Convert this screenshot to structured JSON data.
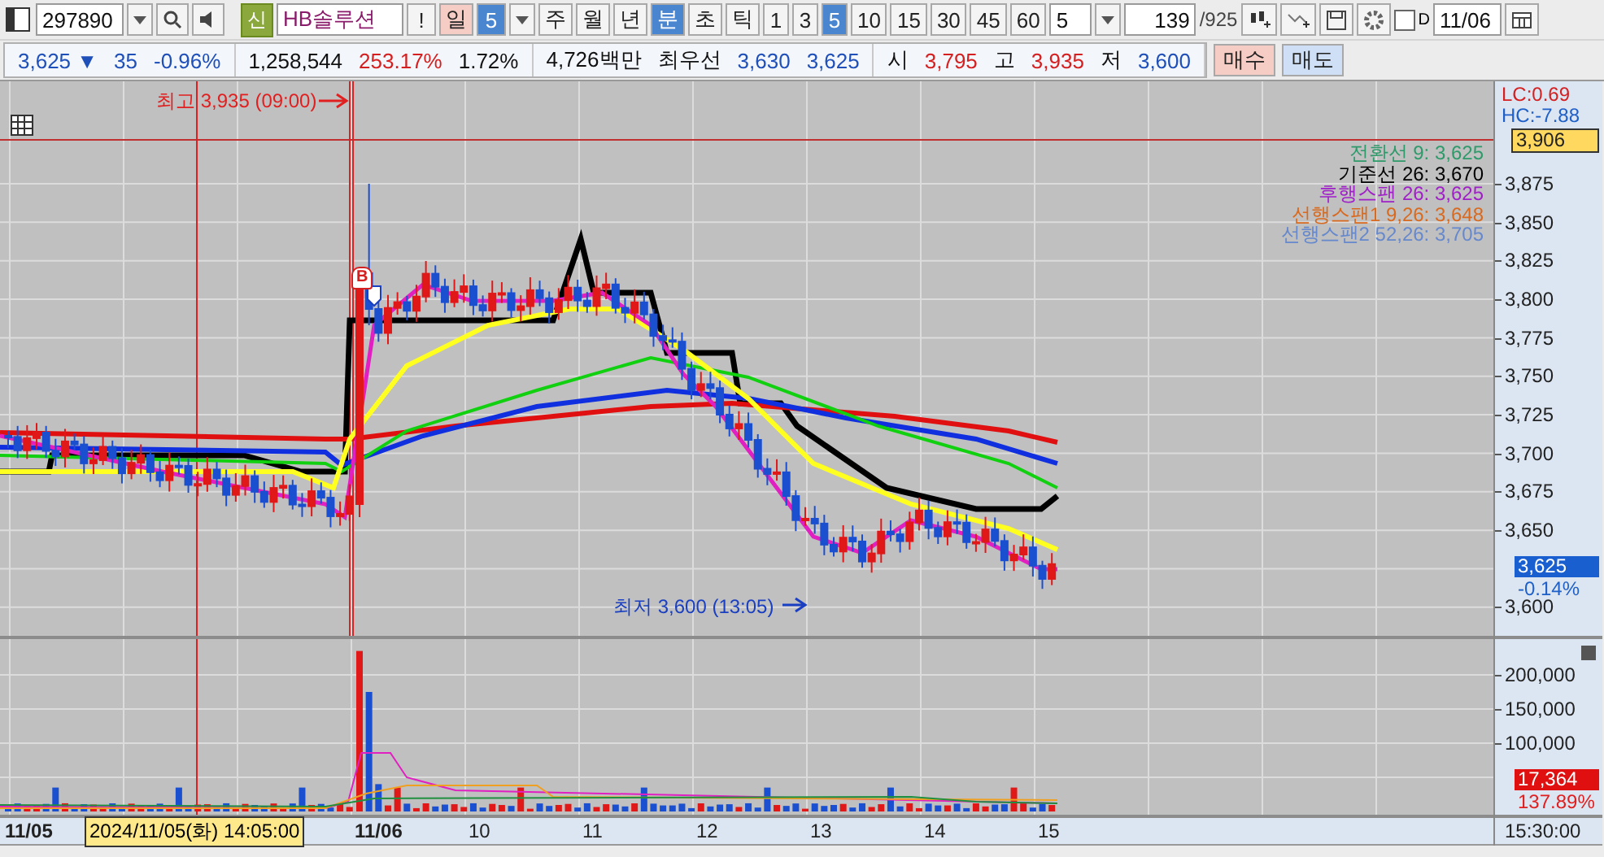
{
  "toolbar": {
    "code": "297890",
    "market_badge": "신",
    "name": "HB솔루션",
    "alert": "!",
    "day_label": "일",
    "day_count": "5",
    "periods": [
      {
        "label": "주",
        "selected": false
      },
      {
        "label": "월",
        "selected": false
      },
      {
        "label": "년",
        "selected": false
      },
      {
        "label": "분",
        "selected": true
      },
      {
        "label": "초",
        "selected": false
      },
      {
        "label": "틱",
        "selected": false
      }
    ],
    "intervals": [
      {
        "label": "1",
        "selected": false
      },
      {
        "label": "3",
        "selected": false
      },
      {
        "label": "5",
        "selected": true
      },
      {
        "label": "10",
        "selected": false
      },
      {
        "label": "15",
        "selected": false
      },
      {
        "label": "30",
        "selected": false
      },
      {
        "label": "45",
        "selected": false
      },
      {
        "label": "60",
        "selected": false
      }
    ],
    "interval_custom": "5",
    "bar_count": "139",
    "bar_total": "/925",
    "date_check": {
      "label": "D",
      "checked": false
    },
    "date": "11/06"
  },
  "quote": {
    "groups": [
      {
        "items": [
          {
            "text": "3,625 ▼",
            "color": "#1f4fb8"
          },
          {
            "text": "35",
            "color": "#1f4fb8"
          },
          {
            "text": "-0.96%",
            "color": "#1f4fb8"
          }
        ]
      },
      {
        "items": [
          {
            "text": "1,258,544",
            "color": "#111111"
          },
          {
            "text": "253.17%",
            "color": "#d42020"
          },
          {
            "text": "1.72%",
            "color": "#111111"
          }
        ]
      },
      {
        "items": [
          {
            "text": "4,726백만",
            "color": "#111111"
          },
          {
            "text": "최우선",
            "color": "#111111"
          },
          {
            "text": "3,630",
            "color": "#1f4fb8"
          },
          {
            "text": "3,625",
            "color": "#1f4fb8"
          }
        ]
      },
      {
        "items": [
          {
            "text": "시",
            "color": "#111111"
          },
          {
            "text": "3,795",
            "color": "#d42020"
          },
          {
            "text": "고",
            "color": "#111111"
          },
          {
            "text": "3,935",
            "color": "#d42020"
          },
          {
            "text": "저",
            "color": "#111111"
          },
          {
            "text": "3,600",
            "color": "#1f4fb8"
          }
        ]
      }
    ],
    "buy": "매수",
    "sell": "매도"
  },
  "chart": {
    "high_note": "최고 3,935 (09:00)",
    "low_note": "최저 3,600 (13:05)",
    "signal_marker": "B",
    "legend": [
      {
        "text": "전환선 9: 3,625",
        "color": "#2e9a6a"
      },
      {
        "text": "기준선 26: 3,670",
        "color": "#000000"
      },
      {
        "text": "후행스팬 26: 3,625",
        "color": "#a020c8"
      },
      {
        "text": "선행스팬1 9,26: 3,648",
        "color": "#d86a20"
      },
      {
        "text": "선행스팬2 52,26: 3,705",
        "color": "#6688cc"
      }
    ],
    "lc": "LC:0.69",
    "hc": "HC:-7.88",
    "cursor_price": "3,906",
    "price_ticks": [
      "3,875",
      "3,850",
      "3,825",
      "3,800",
      "3,775",
      "3,750",
      "3,725",
      "3,700",
      "3,675",
      "3,650",
      "3,600"
    ],
    "last_price": "3,625",
    "last_change": "-0.14%",
    "volume_ticks": [
      "200,000",
      "150,000",
      "100,000"
    ],
    "last_volume": "17,364",
    "volume_ratio": "137.89%",
    "time_labels": [
      {
        "text": "11/05",
        "bold": true
      },
      {
        "text": "11/06",
        "bold": true
      },
      {
        "text": "10",
        "bold": false
      },
      {
        "text": "11",
        "bold": false
      },
      {
        "text": "12",
        "bold": false
      },
      {
        "text": "13",
        "bold": false
      },
      {
        "text": "14",
        "bold": false
      },
      {
        "text": "15",
        "bold": false
      }
    ],
    "cursor_time": "2024/11/05(화) 14:05:00",
    "end_time": "15:30:00"
  }
}
